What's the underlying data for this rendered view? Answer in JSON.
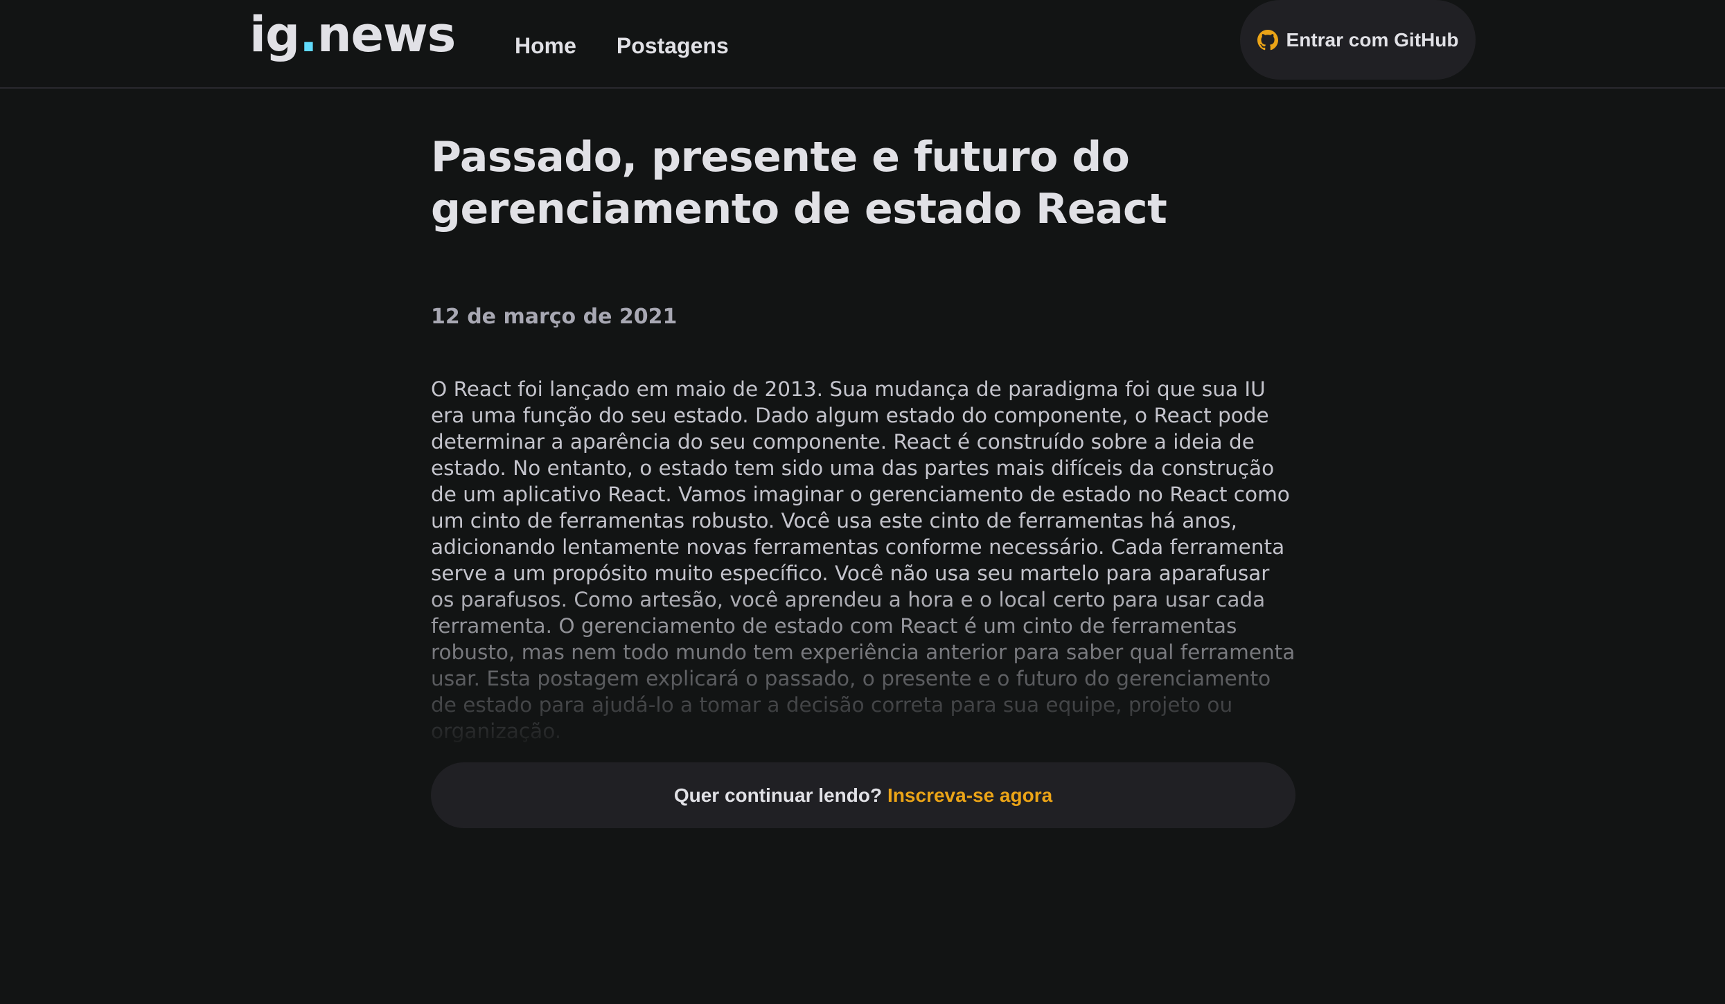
{
  "header": {
    "logo": {
      "prefix": "ig",
      "dot": ".",
      "suffix": "news"
    },
    "nav": [
      {
        "label": "Home"
      },
      {
        "label": "Postagens"
      }
    ],
    "sign_in_button": {
      "label": "Entrar com GitHub",
      "icon": "github-icon",
      "icon_color": "#eba417"
    }
  },
  "post": {
    "title": "Passado, presente e futuro do gerenciamento de estado React",
    "date": "12 de março de 2021",
    "preview": "O React foi lançado em maio de 2013. Sua mudança de paradigma foi que sua IU era uma função do seu estado. Dado algum estado do componente, o React pode determinar a aparência do seu componente. React é construído sobre a ideia de estado. No entanto, o estado tem sido uma das partes mais difíceis da construção de um aplicativo React. Vamos imaginar o gerenciamento de estado no React como um cinto de ferramentas robusto. Você usa este cinto de ferramentas há anos, adicionando lentamente novas ferramentas conforme necessário. Cada ferramenta serve a um propósito muito específico. Você não usa seu martelo para aparafusar os parafusos. Como artesão, você aprendeu a hora e o local certo para usar cada ferramenta. O gerenciamento de estado com React é um cinto de ferramentas robusto, mas nem todo mundo tem experiência anterior para saber qual ferramenta usar. Esta postagem explicará o passado, o presente e o futuro do gerenciamento de estado para ajudá-lo a tomar a decisão correta para sua equipe, projeto ou organização."
  },
  "continue_reading": {
    "text": "Quer continuar lendo?",
    "link_label": "Inscreva-se agora"
  },
  "colors": {
    "background": "#121414",
    "accent_yellow": "#eba417",
    "logo_dot": "#61dafb",
    "surface": "#202024"
  }
}
